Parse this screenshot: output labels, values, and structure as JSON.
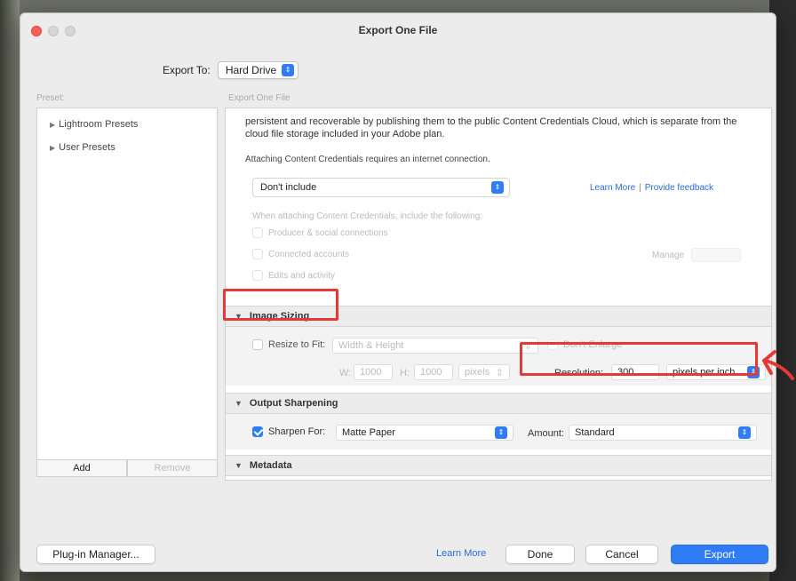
{
  "window": {
    "title": "Export One File"
  },
  "export_to": {
    "label": "Export To:",
    "value": "Hard Drive"
  },
  "presets": {
    "group_label": "Preset:",
    "items": [
      "Lightroom Presets",
      "User Presets"
    ],
    "add_label": "Add",
    "remove_label": "Remove"
  },
  "panel": {
    "group_label": "Export One File",
    "credentials_text": "persistent and recoverable by publishing them to the public Content Credentials Cloud, which is separate from the cloud file storage included in your Adobe plan.",
    "attaching_text": "Attaching Content Credentials requires an internet connection.",
    "include_dropdown": "Don't include",
    "learn_more": "Learn More",
    "link_separator": "|",
    "provide_feedback": "Provide feedback",
    "when_attaching": "When attaching Content Credentials, include the following:",
    "producer_label": "Producer & social connections",
    "connected_accounts": "Connected accounts",
    "edits_activity": "Edits and activity",
    "manage_label": "Manage"
  },
  "image_sizing": {
    "header": "Image Sizing",
    "resize_label": "Resize to Fit:",
    "resize_value": "Width & Height",
    "dont_enlarge": "Don't Enlarge",
    "w_label": "W:",
    "w_value": "1000",
    "h_label": "H:",
    "h_value": "1000",
    "units": "pixels",
    "resolution_label": "Resolution:",
    "resolution_value": "300",
    "resolution_units": "pixels per inch"
  },
  "output_sharpening": {
    "header": "Output Sharpening",
    "sharpen_label": "Sharpen For:",
    "sharpen_value": "Matte Paper",
    "amount_label": "Amount:",
    "amount_value": "Standard"
  },
  "metadata": {
    "header": "Metadata"
  },
  "footer": {
    "plugin_manager": "Plug-in Manager...",
    "learn_more": "Learn More",
    "done": "Done",
    "cancel": "Cancel",
    "export": "Export"
  },
  "colors": {
    "accent": "#2f7cf6",
    "highlight": "#e53935"
  }
}
